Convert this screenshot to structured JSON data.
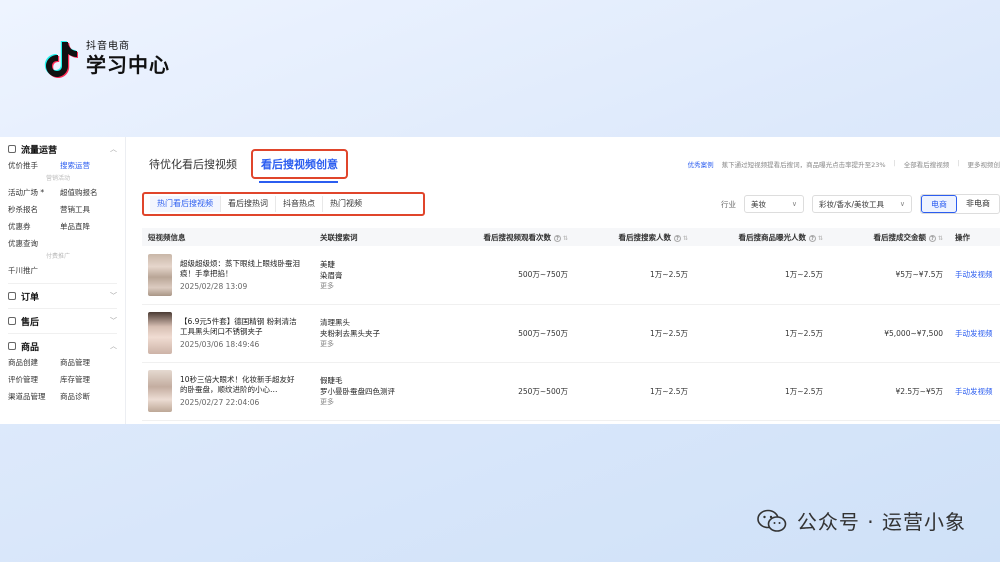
{
  "brand": {
    "small": "抖音电商",
    "big": "学习中心"
  },
  "sidebar": {
    "sections": [
      {
        "title": "流量运营",
        "rows": [
          [
            "优价推手",
            "搜索运营"
          ]
        ],
        "active": "搜索运营"
      }
    ],
    "group_marketing": "营销活动",
    "marketing_rows": [
      [
        "活动广场 *",
        "超值购报名"
      ],
      [
        "秒杀报名",
        "营销工具"
      ],
      [
        "优惠券",
        "单品直降"
      ],
      [
        "优惠查询",
        ""
      ]
    ],
    "group_ads": "付费推广",
    "ads_rows": [
      [
        "千川推广",
        ""
      ]
    ],
    "order": "订单",
    "aftersale": "售后",
    "goods": "商品",
    "goods_rows": [
      [
        "商品创建",
        "商品管理"
      ],
      [
        "评价管理",
        "库存管理"
      ],
      [
        "渠道品管理",
        "商品诊断"
      ]
    ]
  },
  "tabs": {
    "tab1": "待优化看后搜视频",
    "tab2": "看后搜视频创意"
  },
  "top_right": {
    "link": "优秀案例",
    "desc": "蕉下通过短视频提看后搜词，商品曝光点击率提升至23%",
    "all": "全部看后搜视频",
    "more": "更多视频创"
  },
  "subtabs": [
    "热门看后搜视频",
    "看后搜热词",
    "抖音热点",
    "热门视频"
  ],
  "filters": {
    "industry_label": "行业",
    "industry": "美妆",
    "category": "彩妆/香水/美妆工具",
    "seg_on": "电商",
    "seg_off": "非电商"
  },
  "table": {
    "headers": [
      "短视频信息",
      "关联搜索词",
      "看后搜视频观看次数",
      "看后搜搜索人数",
      "看后搜商品曝光人数",
      "看后搜成交金额",
      "操作"
    ],
    "rows": [
      {
        "title": "超级超级烦：蒸下眼线上眼线卧蚕泪痕！手拿把掐！",
        "date": "2025/02/28 13:09",
        "kw1": "美睫",
        "kw2": "染眉膏",
        "more": "更多",
        "views": "500万~750万",
        "searchers": "1万~2.5万",
        "exposure": "1万~2.5万",
        "gmv": "¥5万~¥7.5万",
        "action": "手动发视频"
      },
      {
        "title": "【6.9元5件套】德国精钢 粉刺清洁工具黑头闭口不锈钢夹子",
        "date": "2025/03/06 18:49:46",
        "kw1": "清理黑头",
        "kw2": "夹粉刺去黑头夹子",
        "more": "更多",
        "views": "500万~750万",
        "searchers": "1万~2.5万",
        "exposure": "1万~2.5万",
        "gmv": "¥5,000~¥7,500",
        "action": "手动发视频"
      },
      {
        "title": "10秒三倍大眼术！化妆新手超友好的卧蚕盘，顺纹进阶的小心…",
        "date": "2025/02/27 22:04:06",
        "kw1": "假睫毛",
        "kw2": "罗小曼卧蚕盘四色测评",
        "more": "更多",
        "views": "250万~500万",
        "searchers": "1万~2.5万",
        "exposure": "1万~2.5万",
        "gmv": "¥2.5万~¥5万",
        "action": "手动发视频"
      }
    ]
  },
  "watermark": "公众号 · 运营小象"
}
